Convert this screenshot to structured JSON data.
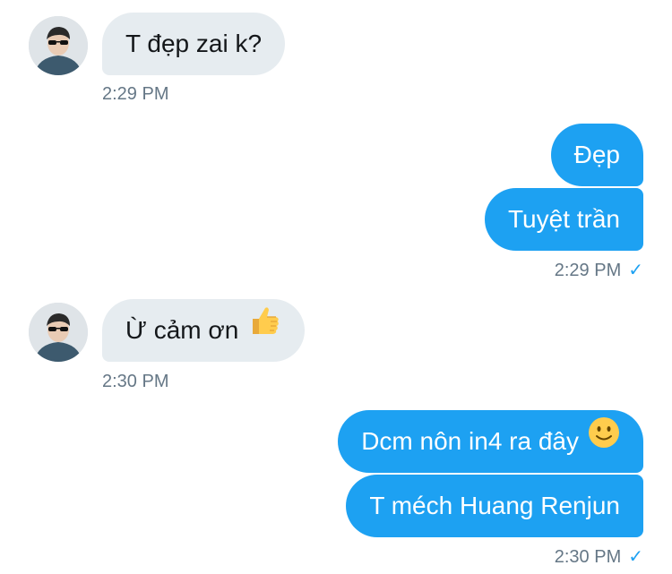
{
  "messages": [
    {
      "side": "in",
      "text": "T đẹp zai k?"
    },
    {
      "side": "out",
      "text": "Đẹp"
    },
    {
      "side": "out",
      "text": "Tuyệt trần"
    },
    {
      "side": "in",
      "text": "Ừ cảm ơn",
      "emoji": "thumbs-up-emoji"
    },
    {
      "side": "out",
      "text": "Dcm nôn in4 ra đây",
      "emoji": "slightly-smiling-face-emoji"
    },
    {
      "side": "out",
      "text": "T méch Huang Renjun"
    }
  ],
  "timestamps": {
    "t1": "2:29 PM",
    "t2": "2:29 PM",
    "t3": "2:30 PM",
    "t4": "2:30 PM"
  },
  "read_receipt": "✓",
  "colors": {
    "outgoing_bubble": "#1da1f2",
    "incoming_bubble": "#e6ecf0",
    "timestamp": "#657786",
    "checkmark": "#1da1f2"
  }
}
